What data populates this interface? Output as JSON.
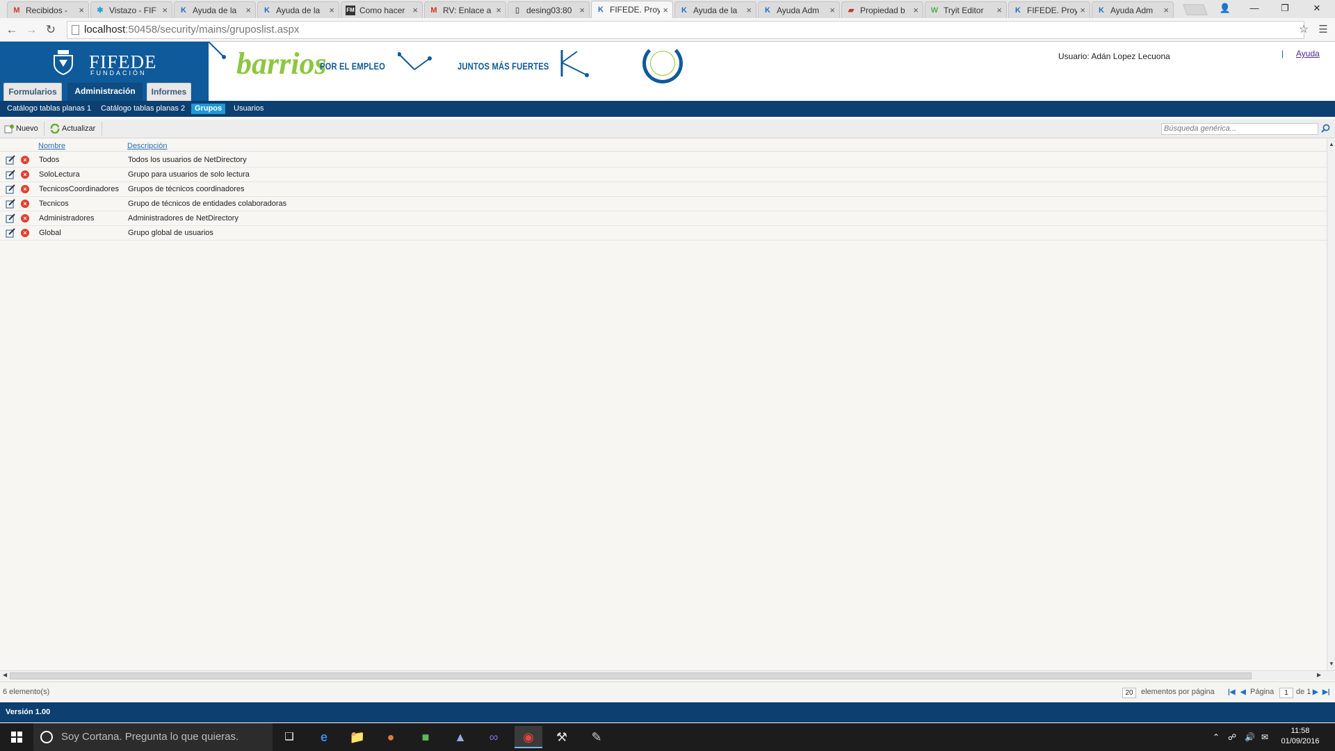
{
  "browser": {
    "tabs": [
      {
        "icon": "gmail-icon",
        "title": "Recibidos - "
      },
      {
        "icon": "snowflake-icon",
        "title": "Vistazo - FIF"
      },
      {
        "icon": "k-app-icon",
        "title": "Ayuda de la"
      },
      {
        "icon": "k-app-icon",
        "title": "Ayuda de la"
      },
      {
        "icon": "fm-icon",
        "title": "Como hacer"
      },
      {
        "icon": "gmail-icon",
        "title": "RV: Enlace a"
      },
      {
        "icon": "page-icon",
        "title": "desing03:80"
      },
      {
        "icon": "k-app-icon",
        "title": "FIFEDE. Proy"
      },
      {
        "icon": "k-app-icon",
        "title": "Ayuda de la"
      },
      {
        "icon": "k-app-icon",
        "title": "Ayuda Adm"
      },
      {
        "icon": "book-icon",
        "title": "Propiedad b"
      },
      {
        "icon": "tryit-icon",
        "title": "Tryit Editor"
      },
      {
        "icon": "k-app-icon",
        "title": "FIFEDE. Proy"
      },
      {
        "icon": "k-app-icon",
        "title": "Ayuda Adm"
      }
    ],
    "active_tab": 7,
    "url_host": "localhost",
    "url_rest": ":50458/security/mains/gruposlist.aspx"
  },
  "header": {
    "brand": "FIFEDE",
    "brand_sub": "FUNDACIÓN",
    "campaign": "barrios",
    "slogan1": "POR EL EMPLEO",
    "slogan2": "JUNTOS MÁS FUERTES",
    "user_label": "Usuario: Adán Lopez Lecuona",
    "separator": "|",
    "help_link": "Ayuda"
  },
  "main_tabs": [
    "Formularios",
    "Administración",
    "Informes"
  ],
  "sub_menu": [
    "Catálogo tablas planas 1",
    "Catálogo tablas planas 2",
    "Grupos",
    "Usuarios"
  ],
  "toolbar": {
    "new_label": "Nuevo",
    "refresh_label": "Actualizar",
    "search_placeholder": "Búsqueda genérica..."
  },
  "grid": {
    "columns": [
      "Nombre",
      "Descripción"
    ],
    "rows": [
      {
        "name": "Todos",
        "desc": "Todos los usuarios de NetDirectory"
      },
      {
        "name": "SoloLectura",
        "desc": "Grupo para usuarios de solo lectura"
      },
      {
        "name": "TecnicosCoordinadores",
        "desc": "Grupos de técnicos coordinadores"
      },
      {
        "name": "Tecnicos",
        "desc": "Grupo de técnicos de entidades colaboradoras"
      },
      {
        "name": "Administradores",
        "desc": "Administradores de NetDirectory"
      },
      {
        "name": "Global",
        "desc": "Grupo global de usuarios"
      }
    ]
  },
  "pager": {
    "count_label": "6 elemento(s)",
    "page_size": "20",
    "page_size_label": "elementos por página",
    "page_label": "Página",
    "page_value": "1",
    "of_label": "de 1"
  },
  "footer": {
    "version": "Versión 1.00"
  },
  "taskbar": {
    "cortana_text": "Soy Cortana. Pregunta lo que quieras.",
    "time": "11:58",
    "date": "01/09/2016"
  },
  "colors": {
    "brand_blue": "#0f5a9a",
    "nav_dark": "#0d3f70",
    "green": "#8dc63f",
    "sub_active": "#1e9ad6"
  }
}
